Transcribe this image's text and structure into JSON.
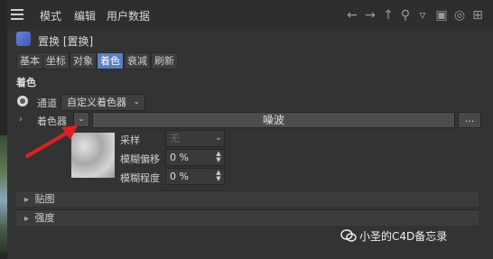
{
  "menu": {
    "items": [
      "模式",
      "编辑",
      "用户数据"
    ],
    "toolbar_icons": [
      "arrow-left-icon",
      "arrow-right-icon",
      "arrow-up-icon",
      "search-icon",
      "filter-icon",
      "lock-icon",
      "target-icon",
      "new-window-icon"
    ]
  },
  "object": {
    "name": "置换 [置换]"
  },
  "tabs": [
    "基本",
    "坐标",
    "对象",
    "着色",
    "衰减",
    "刷新"
  ],
  "active_tab": "着色",
  "section": {
    "title": "着色"
  },
  "channel": {
    "label": "通道",
    "value": "自定义着色器"
  },
  "shader": {
    "label": "着色器",
    "name": "噪波",
    "more": "..."
  },
  "params": {
    "sampling": {
      "label": "采样",
      "value": "无"
    },
    "blur_offset": {
      "label": "模糊偏移",
      "value": "0 %"
    },
    "blur_scale": {
      "label": "模糊程度",
      "value": "0 %"
    }
  },
  "collapsed": [
    "贴图",
    "强度"
  ],
  "watermark": "小圣的C4D备忘录",
  "colors": {
    "accent": "#5a7fc4",
    "annotation_arrow": "#e02020"
  }
}
